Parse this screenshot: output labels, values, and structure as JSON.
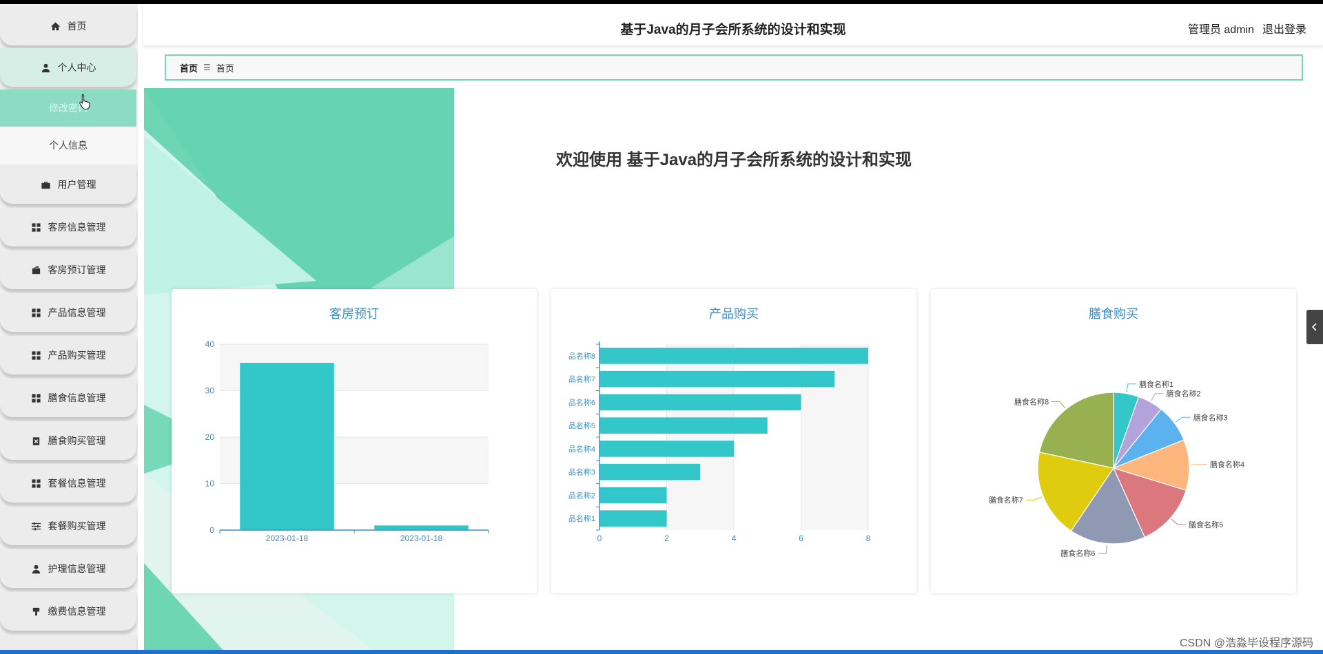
{
  "sidebar": {
    "items": [
      {
        "label": "首页",
        "icon": "home-icon"
      },
      {
        "label": "个人中心",
        "icon": "user-icon"
      },
      {
        "label": "用户管理",
        "icon": "briefcase-icon"
      },
      {
        "label": "客房信息管理",
        "icon": "grid-icon"
      },
      {
        "label": "客房预订管理",
        "icon": "wallet-icon"
      },
      {
        "label": "产品信息管理",
        "icon": "grid-icon"
      },
      {
        "label": "产品购买管理",
        "icon": "grid-icon"
      },
      {
        "label": "膳食信息管理",
        "icon": "grid-icon"
      },
      {
        "label": "膳食购买管理",
        "icon": "clipboard-icon"
      },
      {
        "label": "套餐信息管理",
        "icon": "grid-icon"
      },
      {
        "label": "套餐购买管理",
        "icon": "sliders-icon"
      },
      {
        "label": "护理信息管理",
        "icon": "user-icon"
      },
      {
        "label": "缴费信息管理",
        "icon": "stamp-icon"
      }
    ],
    "subitems": [
      {
        "label": "修改密码"
      },
      {
        "label": "个人信息"
      }
    ]
  },
  "header": {
    "title": "基于Java的月子会所系统的设计和实现",
    "user": "管理员 admin",
    "logout": "退出登录"
  },
  "breadcrumb": {
    "home": "首页",
    "current": "首页"
  },
  "welcome": "欢迎使用 基于Java的月子会所系统的设计和实现",
  "watermark": "CSDN @浩淼毕设程序源码",
  "colors": {
    "accent": "#33c7c9",
    "title_blue": "#3a8fc4",
    "breadcrumb_border": "#74d6b5"
  },
  "chart_data": [
    {
      "type": "bar",
      "title": "客房预订",
      "categories": [
        "2023-01-18",
        "2023-01-18"
      ],
      "values": [
        36,
        1
      ],
      "ylim": [
        0,
        40
      ],
      "yticks": [
        0,
        10,
        20,
        30,
        40
      ],
      "grid": true
    },
    {
      "type": "bar",
      "orientation": "horizontal",
      "title": "产品购买",
      "categories": [
        "品名称1",
        "品名称2",
        "品名称3",
        "品名称4",
        "品名称5",
        "品名称6",
        "品名称7",
        "品名称8"
      ],
      "values": [
        2,
        2,
        3,
        4,
        5,
        6,
        7,
        8
      ],
      "xlim": [
        0,
        8
      ],
      "xticks": [
        0,
        2,
        4,
        6,
        8
      ],
      "grid": true
    },
    {
      "type": "pie",
      "title": "膳食购买",
      "categories": [
        "膳食名称1",
        "膳食名称2",
        "膳食名称3",
        "膳食名称4",
        "膳食名称5",
        "膳食名称6",
        "膳食名称7",
        "膳食名称8"
      ],
      "values": [
        1,
        1,
        1.5,
        2,
        2.5,
        3,
        3.5,
        4
      ],
      "colors": [
        "#33c7c9",
        "#b3a3dc",
        "#5cb2ee",
        "#fdb77c",
        "#db787e",
        "#8f99b1",
        "#e0cc0e",
        "#97b151"
      ]
    }
  ]
}
